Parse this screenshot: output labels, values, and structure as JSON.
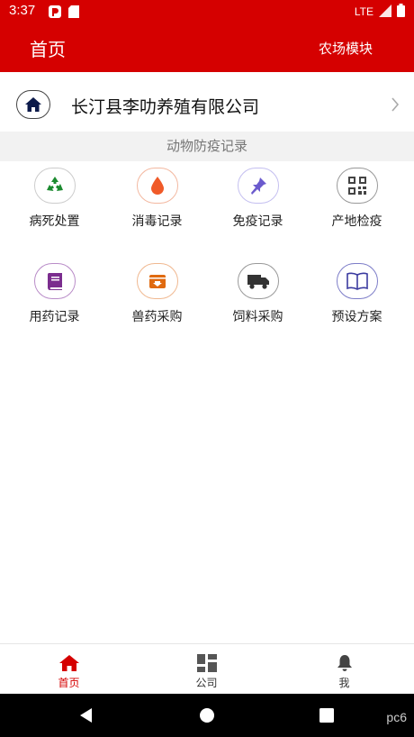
{
  "status_bar": {
    "time": "3:37",
    "network": "LTE"
  },
  "app_bar": {
    "title": "首页",
    "action": "农场模块"
  },
  "company": {
    "name": "长汀县李叻养殖有限公司"
  },
  "section": {
    "title": "动物防疫记录"
  },
  "grid": [
    {
      "label": "病死处置",
      "icon": "recycle-icon",
      "color": "#1b8a2f"
    },
    {
      "label": "消毒记录",
      "icon": "drop-icon",
      "color": "#f05a28"
    },
    {
      "label": "免疫记录",
      "icon": "pin-icon",
      "color": "#6a5acd"
    },
    {
      "label": "产地检疫",
      "icon": "qrcode-icon",
      "color": "#444444"
    },
    {
      "label": "用药记录",
      "icon": "book-icon",
      "color": "#7b2d8e"
    },
    {
      "label": "兽药采购",
      "icon": "inbox-icon",
      "color": "#e06a10"
    },
    {
      "label": "饲料采购",
      "icon": "truck-icon",
      "color": "#333333"
    },
    {
      "label": "预设方案",
      "icon": "open-book-icon",
      "color": "#3b3ba0"
    }
  ],
  "bottom_nav": [
    {
      "label": "首页",
      "icon": "home-icon",
      "active": true
    },
    {
      "label": "公司",
      "icon": "dashboard-icon",
      "active": false
    },
    {
      "label": "我",
      "icon": "bell-icon",
      "active": false
    }
  ],
  "watermark": "pc6",
  "colors": {
    "primary": "#d50000",
    "band": "#f2f2f2"
  }
}
